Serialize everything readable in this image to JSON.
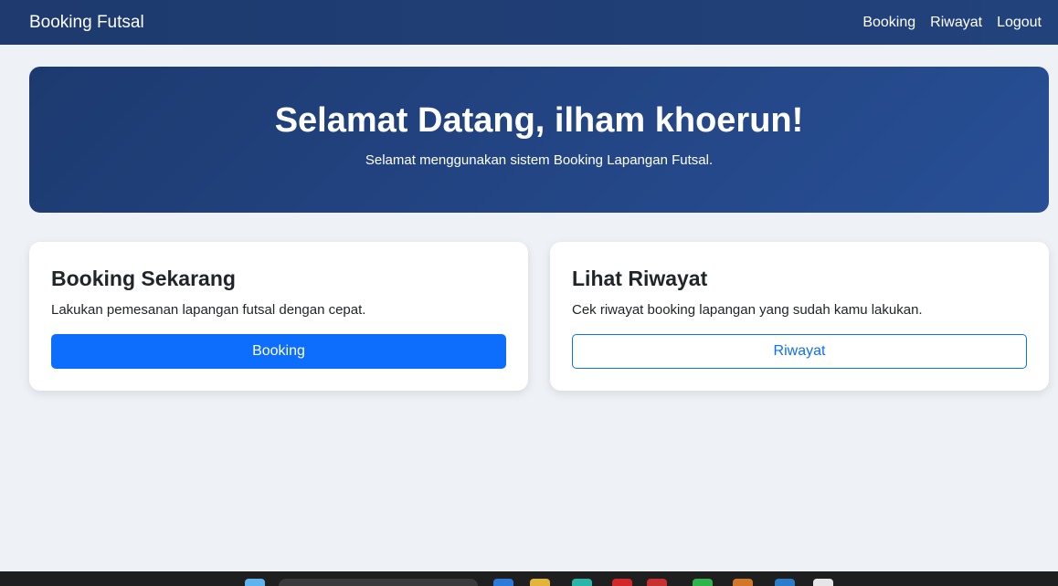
{
  "navbar": {
    "brand": "Booking Futsal",
    "links": [
      {
        "label": "Booking"
      },
      {
        "label": "Riwayat"
      },
      {
        "label": "Logout"
      }
    ]
  },
  "hero": {
    "title": "Selamat Datang, ilham khoerun!",
    "subtitle": "Selamat menggunakan sistem Booking Lapangan Futsal."
  },
  "cards": [
    {
      "title": "Booking Sekarang",
      "text": "Lakukan pemesanan lapangan futsal dengan cepat.",
      "button": "Booking"
    },
    {
      "title": "Lihat Riwayat",
      "text": "Cek riwayat booking lapangan yang sudah kamu lakukan.",
      "button": "Riwayat"
    }
  ],
  "colors": {
    "navbar": "#1e3a6e",
    "hero": "#254a8c",
    "primary": "#0d6efd",
    "background": "#eef1f6"
  }
}
